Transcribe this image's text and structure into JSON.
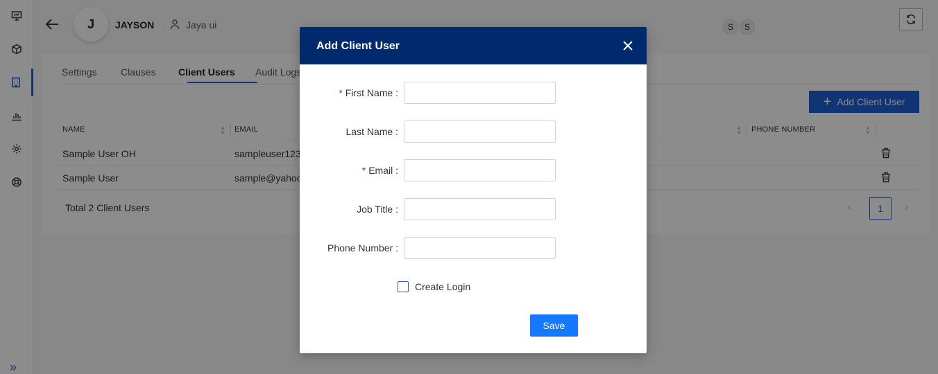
{
  "header": {
    "client_initial": "J",
    "client_name": "JAYSON",
    "user_name": "Jaya ui",
    "avatars": [
      "S",
      "S"
    ]
  },
  "tabs": [
    {
      "label": "Settings"
    },
    {
      "label": "Clauses"
    },
    {
      "label": "Client Users",
      "active": true
    },
    {
      "label": "Audit Logs"
    }
  ],
  "toolbar": {
    "add_label": "Add Client User"
  },
  "table": {
    "columns": [
      "NAME",
      "EMAIL",
      "PHONE NUMBER"
    ],
    "rows": [
      {
        "name": "Sample User OH",
        "email": "sampleuser123"
      },
      {
        "name": "Sample User",
        "email": "sample@yahoo"
      }
    ]
  },
  "footer": {
    "total": "Total 2 Client Users",
    "current_page": "1"
  },
  "modal": {
    "title": "Add Client User",
    "fields": [
      {
        "label": "First Name",
        "required": true,
        "value": ""
      },
      {
        "label": "Last Name",
        "required": false,
        "value": ""
      },
      {
        "label": "Email",
        "required": true,
        "value": ""
      },
      {
        "label": "Job Title",
        "required": false,
        "value": ""
      },
      {
        "label": "Phone Number",
        "required": false,
        "value": ""
      }
    ],
    "label_separator": ":",
    "create_login_label": "Create Login",
    "create_login_checked": false,
    "save_label": "Save"
  },
  "colors": {
    "primary": "#1f5fd6",
    "modal_header": "#002a6e",
    "required_mark": "#e02020"
  }
}
